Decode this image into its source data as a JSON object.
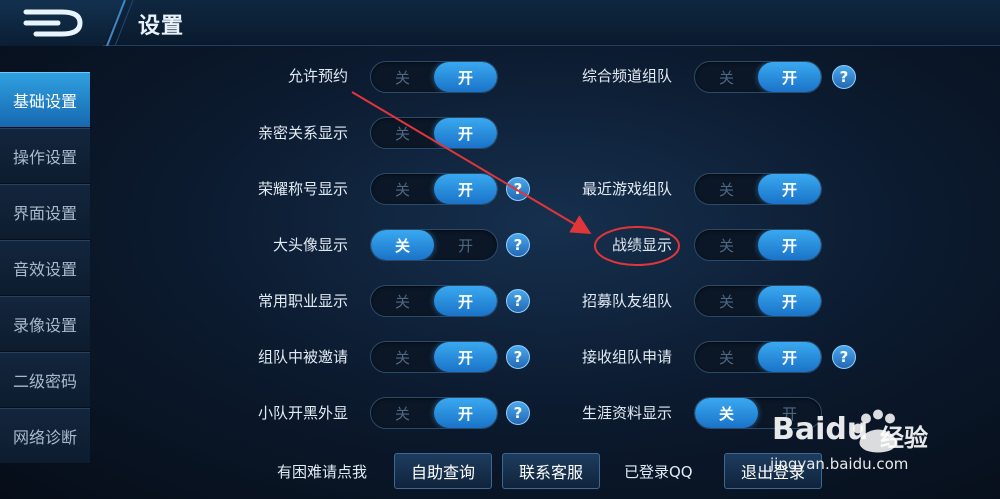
{
  "header": {
    "title": "设置"
  },
  "sidebar": {
    "items": [
      {
        "label": "基础设置",
        "active": true
      },
      {
        "label": "操作设置",
        "active": false
      },
      {
        "label": "界面设置",
        "active": false
      },
      {
        "label": "音效设置",
        "active": false
      },
      {
        "label": "录像设置",
        "active": false
      },
      {
        "label": "二级密码",
        "active": false
      },
      {
        "label": "网络诊断",
        "active": false
      }
    ]
  },
  "toggle_labels": {
    "off": "关",
    "on": "开"
  },
  "help_glyph": "?",
  "settings": {
    "left": [
      {
        "label": "允许预约",
        "value": "开"
      },
      {
        "label": "亲密关系显示",
        "value": "开"
      },
      {
        "label": "荣耀称号显示",
        "value": "开"
      },
      {
        "label": "大头像显示",
        "value": "关"
      },
      {
        "label": "常用职业显示",
        "value": "开"
      },
      {
        "label": "组队中被邀请",
        "value": "开"
      },
      {
        "label": "小队开黑外显",
        "value": "开"
      }
    ],
    "right": [
      {
        "label": "综合频道组队",
        "value": "开"
      },
      {
        "label": "最近游戏组队",
        "value": "开"
      },
      {
        "label": "战绩显示",
        "value": "开"
      },
      {
        "label": "招募队友组队",
        "value": "开"
      },
      {
        "label": "接收组队申请",
        "value": "开"
      },
      {
        "label": "生涯资料显示",
        "value": "关"
      }
    ]
  },
  "bottom": {
    "trouble_label": "有困难请点我",
    "self_help_button": "自助查询",
    "contact_button": "联系客服",
    "login_status": "已登录QQ",
    "logout_button": "退出登录"
  },
  "watermark": {
    "brand": "Bai",
    "brand2": "du",
    "suffix": "经验",
    "url": "jingyan.baidu.com"
  },
  "colors": {
    "accent": "#2a8fe0",
    "annotation": "#e0363a"
  }
}
